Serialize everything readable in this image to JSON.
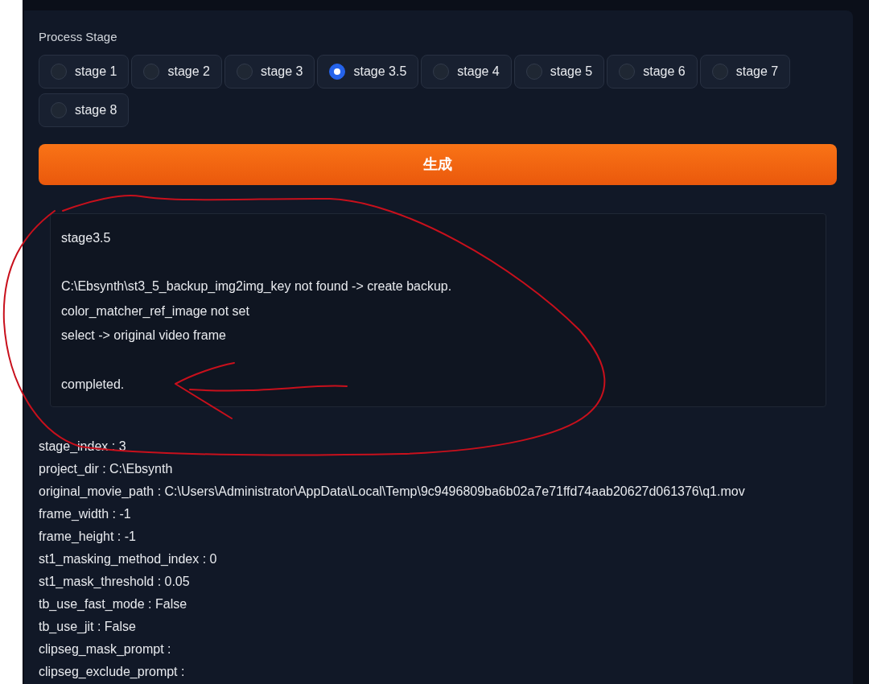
{
  "section": {
    "label": "Process Stage"
  },
  "stages": [
    {
      "label": "stage 1",
      "selected": false
    },
    {
      "label": "stage 2",
      "selected": false
    },
    {
      "label": "stage 3",
      "selected": false
    },
    {
      "label": "stage 3.5",
      "selected": true
    },
    {
      "label": "stage 4",
      "selected": false
    },
    {
      "label": "stage 5",
      "selected": false
    },
    {
      "label": "stage 6",
      "selected": false
    },
    {
      "label": "stage 7",
      "selected": false
    },
    {
      "label": "stage 8",
      "selected": false
    }
  ],
  "generate_button": {
    "label": "生成"
  },
  "output": {
    "paragraphs": [
      [
        "stage3.5"
      ],
      [
        "C:\\Ebsynth\\st3_5_backup_img2img_key not found -> create backup.",
        "color_matcher_ref_image not set",
        "select -> original video frame"
      ],
      [
        "completed."
      ]
    ]
  },
  "settings": [
    "stage_index : 3",
    "project_dir : C:\\Ebsynth",
    "original_movie_path : C:\\Users\\Administrator\\AppData\\Local\\Temp\\9c9496809ba6b02a7e71ffd74aab20627d061376\\q1.mov",
    "frame_width : -1",
    "frame_height : -1",
    "st1_masking_method_index : 0",
    "st1_mask_threshold : 0.05",
    "tb_use_fast_mode : False",
    "tb_use_jit : False",
    "clipseg_mask_prompt :",
    "clipseg_exclude_prompt :"
  ]
}
